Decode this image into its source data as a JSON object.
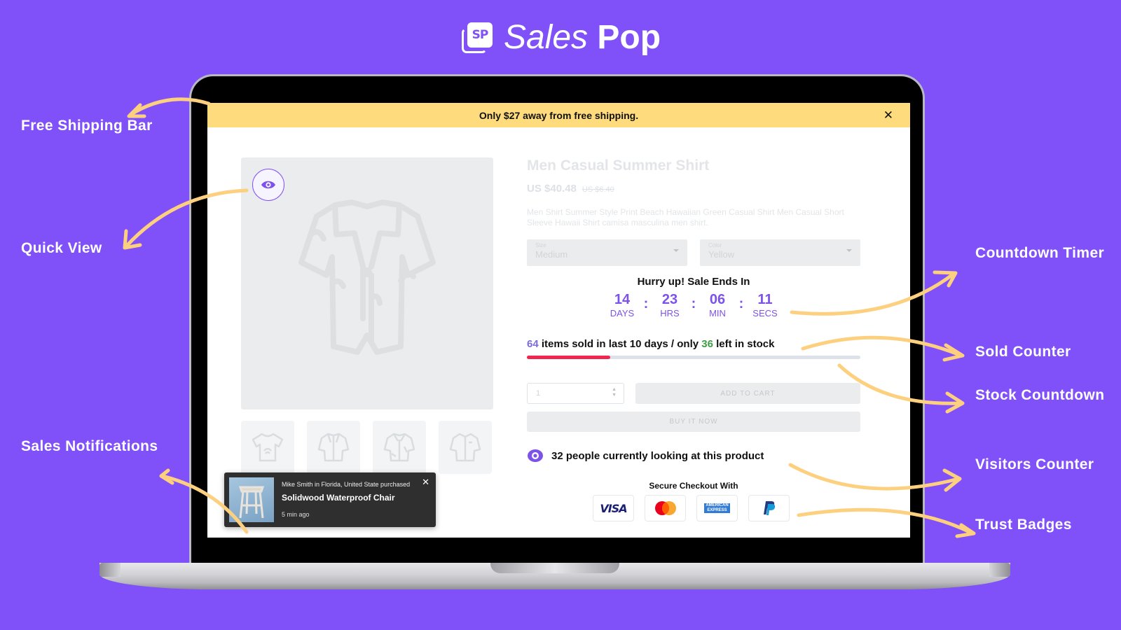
{
  "brand": {
    "logo_mark": "SP",
    "name_light": "Sales",
    "name_bold": "Pop"
  },
  "colors": {
    "background": "#8050f8",
    "accent_purple": "#7d52e8",
    "shipping_bar": "#fedb7d",
    "arrow": "#fdd07f",
    "stock_fill": "#f0264e",
    "stock_track": "#dde2ea",
    "in_stock_green": "#3f9e45"
  },
  "shipping_bar": {
    "message": "Only $27 away from free shipping.",
    "close_icon": "close-icon"
  },
  "product": {
    "title": "Men Casual Summer Shirt",
    "price": "US $40.48",
    "old_price": "US $6.40",
    "description": "Men Shirt Summer Style Print Beach Hawaiian Green Casual Shirt Men Casual Short Sleeve Hawaii Shirt camisa masculina men shirt.",
    "size": {
      "label": "Size",
      "value": "Medium"
    },
    "color": {
      "label": "Color",
      "value": "Yellow"
    },
    "quantity": "1",
    "add_to_cart_label": "ADD TO CART",
    "buy_now_label": "BUY IT NOW",
    "thumbnails": [
      "t-shirt",
      "hawaiian-shirt",
      "printed-shirt",
      "plain-shirt"
    ]
  },
  "countdown": {
    "title": "Hurry up! Sale Ends In",
    "units": [
      {
        "value": "14",
        "label": "DAYS"
      },
      {
        "value": "23",
        "label": "HRS"
      },
      {
        "value": "06",
        "label": "MIN"
      },
      {
        "value": "11",
        "label": "SECS"
      }
    ],
    "separator": ":"
  },
  "sold_counter": {
    "sold": "64",
    "middle": " items sold in last 10 days / only ",
    "left": "36",
    "suffix": " left in stock",
    "stock_progress_percent": 25
  },
  "visitors": {
    "text": "32 people currently looking at this product"
  },
  "trust": {
    "title": "Secure Checkout With",
    "badges": [
      "VISA",
      "Mastercard",
      "American Express",
      "PayPal"
    ],
    "visa_label": "VISA",
    "amex_line1": "AMERICAN",
    "amex_line2": "EXPRESS"
  },
  "notification": {
    "line1": "Mike Smith in Florida, United State purchased",
    "product": "Solidwood Waterproof Chair",
    "time": "5 min ago"
  },
  "callouts": {
    "free_shipping": "Free Shipping Bar",
    "quick_view": "Quick View",
    "sales_notifications": "Sales Notifications",
    "countdown_timer": "Countdown Timer",
    "sold_counter": "Sold Counter",
    "stock_countdown": "Stock Countdown",
    "visitors_counter": "Visitors Counter",
    "trust_badges": "Trust Badges"
  }
}
